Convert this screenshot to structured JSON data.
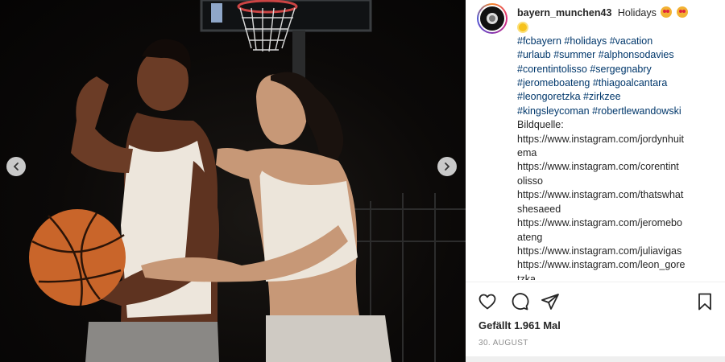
{
  "post": {
    "username": "bayern_munchen43",
    "caption_text": "Holidays",
    "hashtags": [
      "#fcbayern",
      "#holidays",
      "#vacation",
      "#urlaub",
      "#summer",
      "#alphonsodavies",
      "#corentintolisso",
      "#sergegnabry",
      "#jeromeboateng",
      "#thiagoalcantara",
      "#leongoretzka",
      "#zirkzee",
      "#kingsleycoman",
      "#robertlewandowski"
    ],
    "source_label": "Bildquelle:",
    "source_lines": [
      "https://www.instagram.com/jordynhuit",
      "ema",
      "https://www.instagram.com/corentint",
      "olisso",
      "https://www.instagram.com/thatswhat",
      "shesaeed",
      "https://www.instagram.com/jeromebo",
      "ateng",
      "https://www.instagram.com/juliavigas",
      "https://www.instagram.com/leon_gore",
      "tzka"
    ],
    "likes": "Gefällt 1.961 Mal",
    "date": "30. AUGUST"
  },
  "icons": {
    "like": "heart-icon",
    "comment": "comment-icon",
    "share": "paper-plane-icon",
    "save": "bookmark-icon",
    "prev": "chevron-left-icon",
    "next": "chevron-right-icon"
  },
  "colors": {
    "hashtag": "#00376b",
    "text": "#262626",
    "muted": "#8e8e8e"
  }
}
